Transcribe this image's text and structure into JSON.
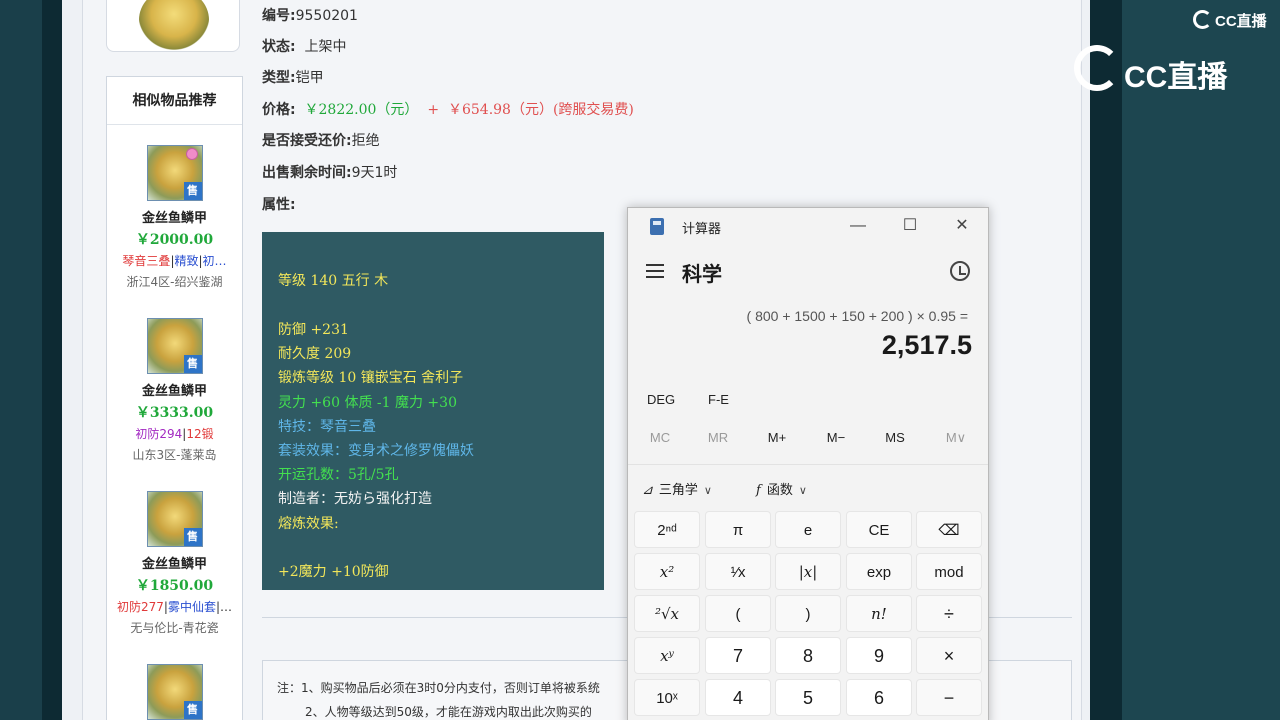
{
  "item": {
    "labels": {
      "id": "编号:",
      "status": "状态:",
      "type": "类型:",
      "price": "价格:",
      "bargain": "是否接受还价:",
      "remaining": "出售剩余时间:",
      "attributes": "属性:"
    },
    "id": "9550201",
    "status": "上架中",
    "type": "铠甲",
    "price": "￥2822.00（元）",
    "plus": "+",
    "fee": "￥654.98（元）(跨服交易费)",
    "bargain": "拒绝",
    "remaining": "9天1时"
  },
  "attributes": {
    "grade": "等级 140 五行 木",
    "defense": "防御 +231",
    "durability": "耐久度 209",
    "forge": "锻炼等级 10 镶嵌宝石 舍利子",
    "stats": "灵力 +60 体质 -1 魔力 +30",
    "skill": "特技：琴音三叠",
    "set_effect": "套装效果：变身术之修罗傀儡妖",
    "holes": "开运孔数：5孔/5孔",
    "maker": "制造者：无妨ら强化打造",
    "melt": "熔炼效果:",
    "melt_value": "+2魔力 +10防御"
  },
  "sidebar": {
    "title": "相似物品推荐",
    "badge": "售",
    "items": [
      {
        "name": "金丝鱼鳞甲",
        "price": "￥2000.00",
        "tags": [
          {
            "text": "琴音三叠",
            "color": "red"
          },
          {
            "text": "|",
            "color": "sep"
          },
          {
            "text": "精致",
            "color": "blue"
          },
          {
            "text": "|",
            "color": "sep"
          },
          {
            "text": "初…",
            "color": "blue"
          }
        ],
        "server": "浙江4区-绍兴鉴湖"
      },
      {
        "name": "金丝鱼鳞甲",
        "price": "￥3333.00",
        "tags": [
          {
            "text": "初防294",
            "color": "purple"
          },
          {
            "text": "|",
            "color": "sep"
          },
          {
            "text": "12锻",
            "color": "red"
          }
        ],
        "server": "山东3区-蓬莱岛"
      },
      {
        "name": "金丝鱼鳞甲",
        "price": "￥1850.00",
        "tags": [
          {
            "text": "初防277",
            "color": "red"
          },
          {
            "text": "|",
            "color": "sep"
          },
          {
            "text": "雾中仙套",
            "color": "blue"
          },
          {
            "text": "|…",
            "color": "sep"
          }
        ],
        "server": "无与伦比-青花瓷"
      }
    ]
  },
  "notes": {
    "line1": "注：1、购买物品后必须在3时0分内支付，否则订单将被系统",
    "line2": "2、人物等级达到50级，才能在游戏内取出此次购买的"
  },
  "calculator": {
    "title": "计算器",
    "mode": "科学",
    "expression": "( 800 + 1500 + 150 + 200 ) × 0.95 =",
    "result": "2,517.5",
    "window_buttons": {
      "minimize": "—",
      "maximize": "☐",
      "close": "✕"
    },
    "modes": [
      "DEG",
      "F-E"
    ],
    "memory": [
      "MC",
      "MR",
      "M+",
      "M−",
      "MS",
      "M∨"
    ],
    "trig_label": "三角学",
    "func_label": "函数",
    "keys": [
      [
        "2ⁿᵈ",
        "π",
        "e",
        "CE",
        "⌫"
      ],
      [
        "x²",
        "¹⁄x",
        "|x|",
        "exp",
        "mod"
      ],
      [
        "²√x",
        "(",
        ")",
        "n!",
        "÷"
      ],
      [
        "xʸ",
        "7",
        "8",
        "9",
        "×"
      ],
      [
        "10ˣ",
        "4",
        "5",
        "6",
        "−"
      ]
    ]
  },
  "branding": {
    "logo_small": "CC直播",
    "logo_big": "CC直播"
  },
  "colors": {
    "price_green": "#20a83a",
    "price_red": "#e05050",
    "attr_bg": "#2f5a63",
    "frame": "#1d4650"
  }
}
